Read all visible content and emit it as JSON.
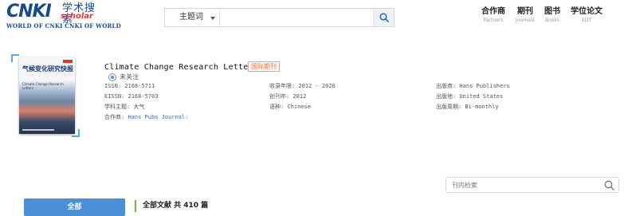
{
  "header": {
    "logo": {
      "main": "CNKI",
      "cn": "学术搜索",
      "scholar": "scholar",
      "sub": "WORLD OF CNKI CNKI OF WORLD"
    },
    "search": {
      "type_label": "主题词",
      "placeholder": "",
      "value": ""
    },
    "nav": [
      {
        "cn": "合作商",
        "en": "Partners"
      },
      {
        "cn": "期刊",
        "en": "Journals"
      },
      {
        "cn": "图书",
        "en": "Books"
      },
      {
        "cn": "学位论文",
        "en": "EDT"
      }
    ]
  },
  "journal": {
    "cover": {
      "cn_title": "气候变化研究快报",
      "en_title": "Climate Change Research Letters"
    },
    "title": "Climate Change Research Letters",
    "tag": "国际期刊",
    "follow": "未关注",
    "meta": {
      "issn": "ISSN: 2168-5711",
      "eissn": "EISSN: 2168-5703",
      "subject": "学科主题: 大气",
      "partner_label": "合作商:",
      "partner_value": "Hans Pubs Journal:",
      "years": "收录年限: 2012 - 2026",
      "founded": "创刊年: 2012",
      "language": "语种: Chinese",
      "publisher": "出版商: Hans Publishers",
      "place": "出版地: United States",
      "cycle": "出版周期: Bi-monthly"
    }
  },
  "toolbar": {
    "inner_search_placeholder": "刊内检索",
    "all_button": "全部",
    "count_text": "全部文献 共 410 篇"
  },
  "colors": {
    "brand": "#1a4a8c",
    "accent": "#4a8fd8",
    "tag": "#e86a2c",
    "divider": "#6fba3a"
  }
}
